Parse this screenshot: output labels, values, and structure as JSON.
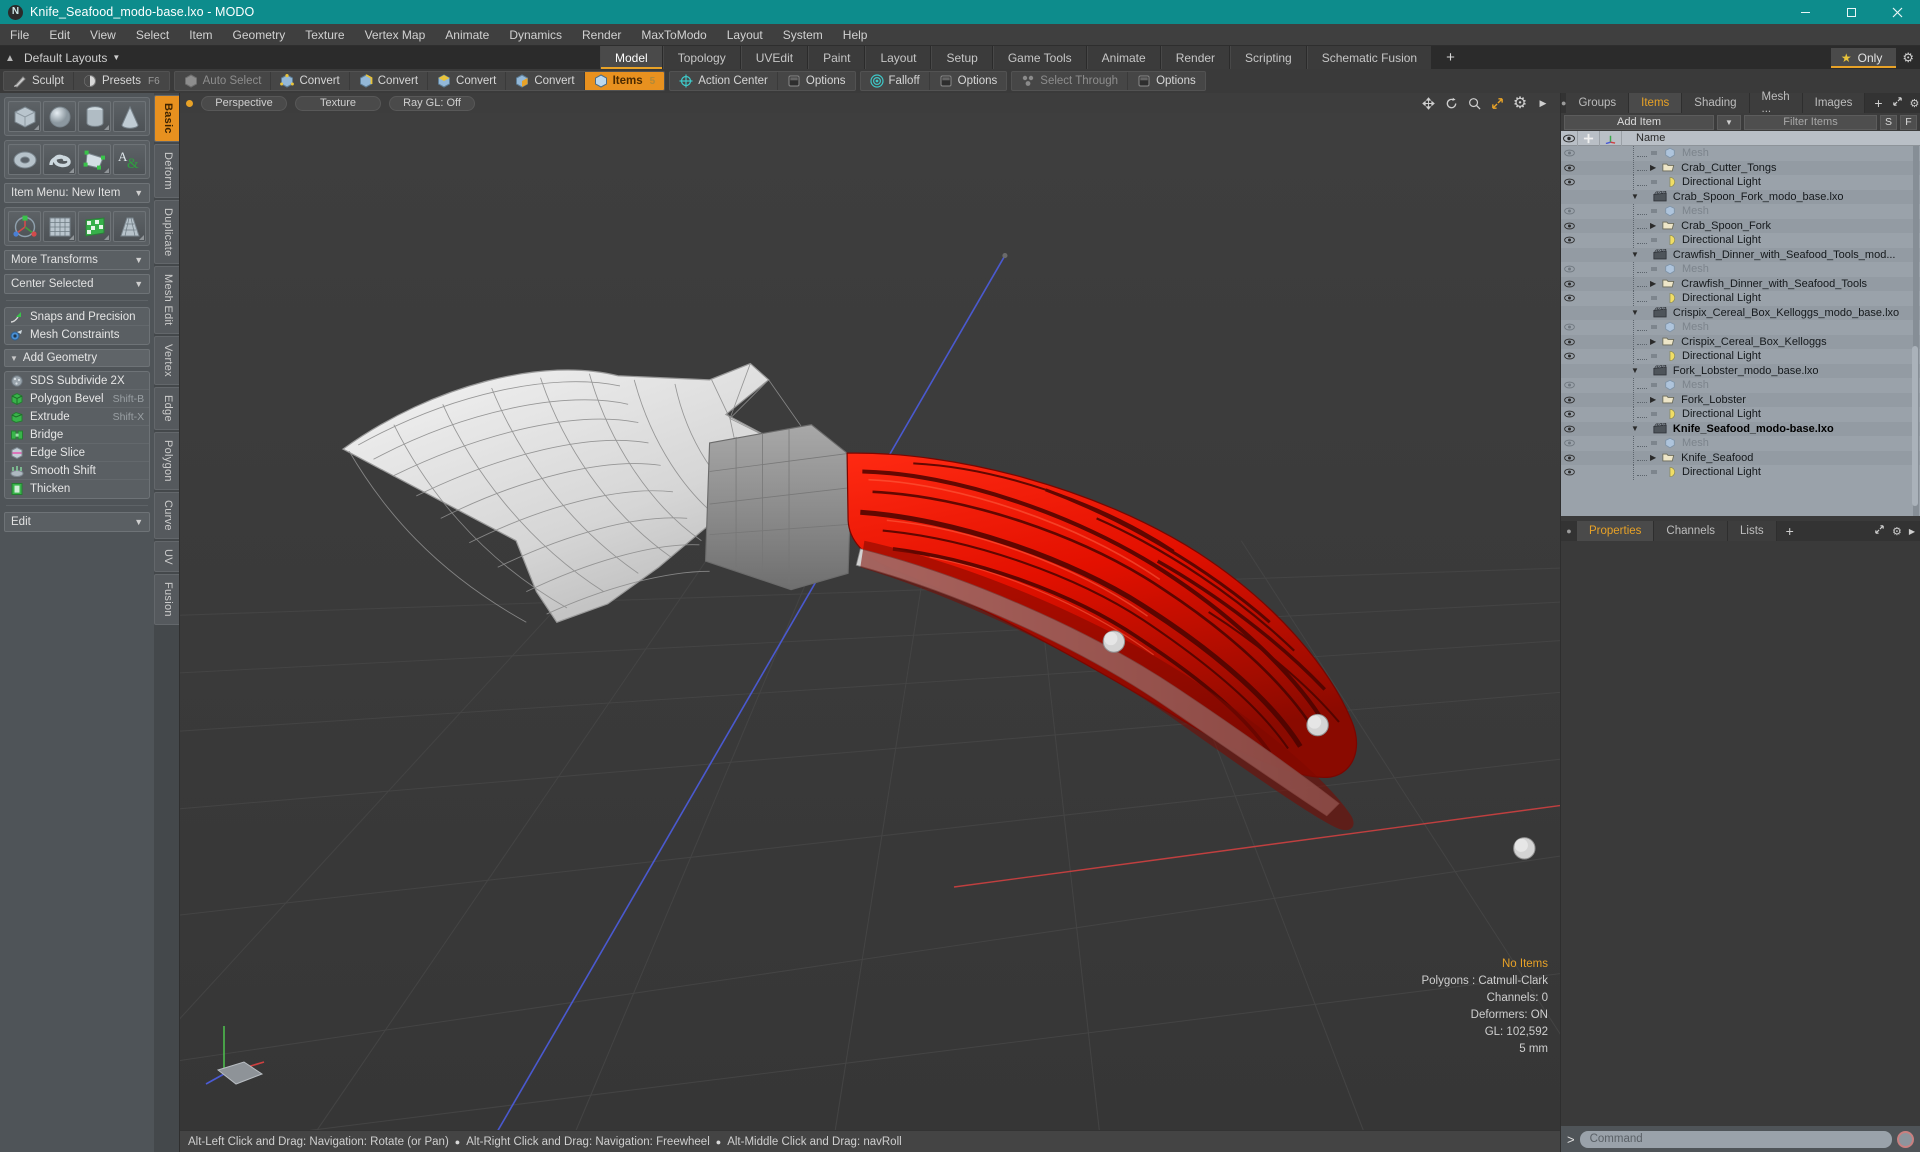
{
  "window": {
    "title": "Knife_Seafood_modo-base.lxo - MODO",
    "logo_glyph": "N",
    "minimize": "minimize-icon",
    "maximize": "maximize-icon",
    "close": "close-icon"
  },
  "menubar": {
    "items": [
      "File",
      "Edit",
      "View",
      "Select",
      "Item",
      "Geometry",
      "Texture",
      "Vertex Map",
      "Animate",
      "Dynamics",
      "Render",
      "MaxToModo",
      "Layout",
      "System",
      "Help"
    ]
  },
  "layoutbar": {
    "default_layouts": "Default Layouts",
    "tabs": [
      "Model",
      "Topology",
      "UVEdit",
      "Paint",
      "Layout",
      "Setup",
      "Game Tools",
      "Animate",
      "Render",
      "Scripting",
      "Schematic Fusion"
    ],
    "active_tab": "Model",
    "plus": "+",
    "only_label": "Only",
    "star_icon": "star-icon",
    "gear_icon": "gear-icon"
  },
  "modebar": {
    "group1": [
      {
        "label": "Sculpt",
        "icon": "sculpt-icon",
        "state": "normal"
      },
      {
        "label": "Presets",
        "icon": "presets-icon",
        "shortcut": "F6",
        "state": "normal"
      }
    ],
    "group2": [
      {
        "label": "Auto Select",
        "icon": "cube-grey-icon",
        "state": "dim"
      },
      {
        "label": "Convert",
        "icon": "vertex-convert-icon",
        "state": "normal"
      },
      {
        "label": "Convert",
        "icon": "edge-convert-icon",
        "state": "normal"
      },
      {
        "label": "Convert",
        "icon": "polygon-convert-icon",
        "state": "normal"
      },
      {
        "label": "Convert",
        "icon": "material-convert-icon",
        "state": "normal"
      },
      {
        "label": "Items",
        "icon": "items-icon",
        "state": "active",
        "shortcut": "5"
      }
    ],
    "group3": [
      {
        "label": "Action Center",
        "icon": "action-center-icon",
        "state": "normal"
      },
      {
        "label": "Options",
        "icon": "options-icon",
        "state": "normal"
      }
    ],
    "group4": [
      {
        "label": "Falloff",
        "icon": "falloff-icon",
        "state": "normal"
      },
      {
        "label": "Options",
        "icon": "options-icon",
        "state": "normal"
      }
    ],
    "group5": [
      {
        "label": "Select Through",
        "icon": "select-through-icon",
        "state": "dim"
      },
      {
        "label": "Options",
        "icon": "options-icon",
        "state": "normal"
      }
    ]
  },
  "leftpanel": {
    "primitive_tiles_row1": [
      "cube-tool",
      "sphere-tool",
      "cylinder-tool",
      "cone-tool"
    ],
    "primitive_tiles_row2": [
      "torus-tool",
      "spiral-tool",
      "polygon-tool",
      "text-tool"
    ],
    "item_menu": "Item Menu: New Item",
    "transform_tiles": [
      "transform-gizmo-tool",
      "mesh-grid-tool",
      "checker-mesh-tool",
      "taper-mesh-tool"
    ],
    "more_transforms": "More Transforms",
    "center_selected": "Center Selected",
    "snaps_and_precision": "Snaps and Precision",
    "mesh_constraints": "Mesh Constraints",
    "add_geometry": "Add Geometry",
    "tools": [
      {
        "label": "SDS Subdivide 2X",
        "shortcut": "",
        "icon": "sds-subdivide-icon"
      },
      {
        "label": "Polygon Bevel",
        "shortcut": "Shift-B",
        "icon": "polygon-bevel-icon"
      },
      {
        "label": "Extrude",
        "shortcut": "Shift-X",
        "icon": "extrude-icon"
      },
      {
        "label": "Bridge",
        "shortcut": "",
        "icon": "bridge-icon"
      },
      {
        "label": "Edge Slice",
        "shortcut": "",
        "icon": "edge-slice-icon"
      },
      {
        "label": "Smooth Shift",
        "shortcut": "",
        "icon": "smooth-shift-icon"
      },
      {
        "label": "Thicken",
        "shortcut": "",
        "icon": "thicken-icon"
      }
    ],
    "edit_dropdown": "Edit",
    "vtabs": [
      "Basic",
      "Deform",
      "Duplicate",
      "Mesh Edit",
      "Vertex",
      "Edge",
      "Polygon",
      "Curve",
      "UV",
      "Fusion"
    ],
    "vtab_active": "Basic"
  },
  "viewport": {
    "header_pills": [
      "Perspective",
      "Texture",
      "Ray GL: Off"
    ],
    "header_icons": [
      "move-icon",
      "rotate-icon",
      "zoom-icon",
      "fit-icon",
      "gear-icon",
      "chevron-right-icon"
    ],
    "info": {
      "items": "No Items",
      "polygons": "Polygons : Catmull-Clark",
      "channels": "Channels: 0",
      "deformers": "Deformers: ON",
      "gl": "GL: 102,592",
      "scale": "5 mm"
    },
    "gizmo_label": "axis-gizmo"
  },
  "statusbar": {
    "hints": [
      "Alt-Left Click and Drag: Navigation: Rotate (or Pan)",
      "Alt-Right Click and Drag: Navigation: Freewheel",
      "Alt-Middle Click and Drag: navRoll"
    ]
  },
  "rightpanel": {
    "tabs": [
      "Groups",
      "Items",
      "Shading",
      "Mesh ...",
      "Images"
    ],
    "active_tab": "Items",
    "tab_plus": "+",
    "tab_icons": [
      "expand-icon",
      "gear-icon",
      "chevron-right-icon"
    ],
    "add_item": "Add Item",
    "filter_placeholder": "Filter Items",
    "s_button": "S",
    "f_button": "F",
    "columns": [
      "eye-icon",
      "lock-icon",
      "axis-icon",
      "Name"
    ],
    "rows": [
      {
        "label": "Mesh",
        "depth": 2,
        "kind": "mesh",
        "eye": true,
        "expand": "none",
        "dim": true,
        "bold": false
      },
      {
        "label": "Crab_Cutter_Tongs",
        "depth": 2,
        "kind": "folder",
        "eye": true,
        "expand": "right",
        "dim": false,
        "bold": false
      },
      {
        "label": "Directional Light",
        "depth": 2,
        "kind": "light",
        "eye": true,
        "expand": "none",
        "dim": false,
        "bold": false
      },
      {
        "label": "Crab_Spoon_Fork_modo_base.lxo",
        "depth": 1,
        "kind": "scene",
        "eye": false,
        "expand": "down",
        "dim": false,
        "bold": false
      },
      {
        "label": "Mesh",
        "depth": 2,
        "kind": "mesh",
        "eye": true,
        "expand": "none",
        "dim": true,
        "bold": false
      },
      {
        "label": "Crab_Spoon_Fork",
        "depth": 2,
        "kind": "folder",
        "eye": true,
        "expand": "right",
        "dim": false,
        "bold": false
      },
      {
        "label": "Directional Light",
        "depth": 2,
        "kind": "light",
        "eye": true,
        "expand": "none",
        "dim": false,
        "bold": false
      },
      {
        "label": "Crawfish_Dinner_with_Seafood_Tools_mod...",
        "depth": 1,
        "kind": "scene",
        "eye": false,
        "expand": "down",
        "dim": false,
        "bold": false
      },
      {
        "label": "Mesh",
        "depth": 2,
        "kind": "mesh",
        "eye": true,
        "expand": "none",
        "dim": true,
        "bold": false
      },
      {
        "label": "Crawfish_Dinner_with_Seafood_Tools",
        "depth": 2,
        "kind": "folder",
        "eye": true,
        "expand": "right",
        "dim": false,
        "bold": false
      },
      {
        "label": "Directional Light",
        "depth": 2,
        "kind": "light",
        "eye": true,
        "expand": "none",
        "dim": false,
        "bold": false
      },
      {
        "label": "Crispix_Cereal_Box_Kelloggs_modo_base.lxo",
        "depth": 1,
        "kind": "scene",
        "eye": false,
        "expand": "down",
        "dim": false,
        "bold": false
      },
      {
        "label": "Mesh",
        "depth": 2,
        "kind": "mesh",
        "eye": true,
        "expand": "none",
        "dim": true,
        "bold": false
      },
      {
        "label": "Crispix_Cereal_Box_Kelloggs",
        "depth": 2,
        "kind": "folder",
        "eye": true,
        "expand": "right",
        "dim": false,
        "bold": false
      },
      {
        "label": "Directional Light",
        "depth": 2,
        "kind": "light",
        "eye": true,
        "expand": "none",
        "dim": false,
        "bold": false
      },
      {
        "label": "Fork_Lobster_modo_base.lxo",
        "depth": 1,
        "kind": "scene",
        "eye": false,
        "expand": "down",
        "dim": false,
        "bold": false
      },
      {
        "label": "Mesh",
        "depth": 2,
        "kind": "mesh",
        "eye": true,
        "expand": "none",
        "dim": true,
        "bold": false
      },
      {
        "label": "Fork_Lobster",
        "depth": 2,
        "kind": "folder",
        "eye": true,
        "expand": "right",
        "dim": false,
        "bold": false
      },
      {
        "label": "Directional Light",
        "depth": 2,
        "kind": "light",
        "eye": true,
        "expand": "none",
        "dim": false,
        "bold": false
      },
      {
        "label": "Knife_Seafood_modo-base.lxo",
        "depth": 1,
        "kind": "scene",
        "eye": true,
        "expand": "down",
        "dim": false,
        "bold": true
      },
      {
        "label": "Mesh",
        "depth": 2,
        "kind": "mesh",
        "eye": true,
        "expand": "none",
        "dim": true,
        "bold": false
      },
      {
        "label": "Knife_Seafood",
        "depth": 2,
        "kind": "folder",
        "eye": true,
        "expand": "right",
        "dim": false,
        "bold": false
      },
      {
        "label": "Directional Light",
        "depth": 2,
        "kind": "light",
        "eye": true,
        "expand": "none",
        "dim": false,
        "bold": false
      }
    ],
    "properties_tabs": [
      "Properties",
      "Channels",
      "Lists"
    ],
    "properties_active": "Properties",
    "properties_plus": "+",
    "properties_icons": [
      "expand-icon",
      "gear-icon",
      "chevron-right-icon"
    ]
  },
  "command": {
    "prompt": ">",
    "placeholder": "Command",
    "record_icon": "record-icon"
  },
  "colors": {
    "accent": "#e8911f",
    "title_bar": "#0d8c8c",
    "panel": "#3a3a3a",
    "left_panel": "#4f5458",
    "list_bg": "#9aa2aa",
    "blade": "#d8d8d8",
    "handle_red": "#e01b0a"
  }
}
